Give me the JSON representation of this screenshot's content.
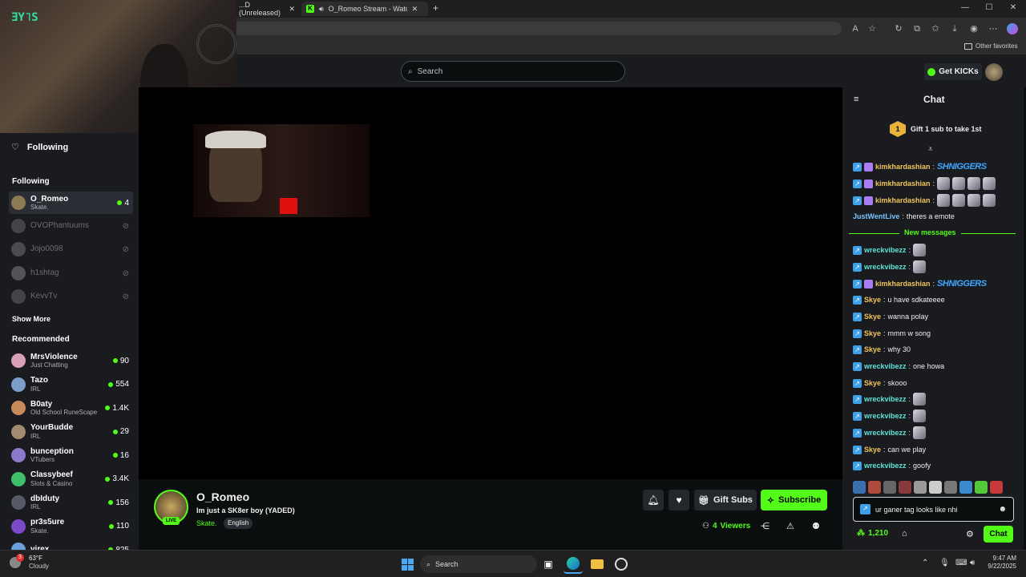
{
  "browser": {
    "tabs": [
      {
        "label": "...D (Unreleased)"
      },
      {
        "label": "O_Romeo Stream - Watch Li..."
      }
    ],
    "other_favorites": "Other favorites"
  },
  "header": {
    "search_placeholder": "Search",
    "get_kicks": "Get KICKs"
  },
  "sidebar": {
    "top_label": "Following",
    "following_title": "Following",
    "following": [
      {
        "name": "O_Romeo",
        "category": "Skate.",
        "viewers": "4",
        "live": true,
        "color": "#8c7a55"
      },
      {
        "name": "OVOPhantuums",
        "live": false,
        "color": "#777"
      },
      {
        "name": "Jojo0098",
        "live": false,
        "color": "#888"
      },
      {
        "name": "h1shtag",
        "live": false,
        "color": "#999"
      },
      {
        "name": "KevvTv",
        "live": false,
        "color": "#777"
      }
    ],
    "show_more": "Show More",
    "recommended_title": "Recommended",
    "recommended": [
      {
        "name": "MrsViolence",
        "category": "Just Chatting",
        "viewers": "90",
        "color": "#d9a0b8"
      },
      {
        "name": "Tazo",
        "category": "IRL",
        "viewers": "554",
        "color": "#7a9ec9"
      },
      {
        "name": "B0aty",
        "category": "Old School RuneScape",
        "viewers": "1.4K",
        "color": "#c98a5a"
      },
      {
        "name": "YourBudde",
        "category": "IRL",
        "viewers": "29",
        "color": "#a08a70"
      },
      {
        "name": "bunception",
        "category": "VTubers",
        "viewers": "16",
        "color": "#8a7ac9"
      },
      {
        "name": "Classybeef",
        "category": "Slots & Casino",
        "viewers": "3.4K",
        "color": "#3fbf6a"
      },
      {
        "name": "dbIduty",
        "category": "IRL",
        "viewers": "156",
        "color": "#555a66"
      },
      {
        "name": "pr3s5ure",
        "category": "Skate.",
        "viewers": "110",
        "color": "#7a4ac9"
      },
      {
        "name": "virex",
        "category": "",
        "viewers": "825",
        "color": "#6aa0d9"
      }
    ]
  },
  "stream": {
    "streamer": "O_Romeo",
    "title": "Im just a SK8er boy (YADED)",
    "category": "Skate.",
    "language": "English",
    "live_badge": "LIVE",
    "viewers": "4",
    "viewers_label": "Viewers",
    "gift_subs": "Gift Subs",
    "subscribe": "Subscribe"
  },
  "chat": {
    "title": "Chat",
    "gift_banner": "Gift 1 sub to take 1st",
    "gift_rank": "1",
    "new_messages": "New messages",
    "messages": [
      {
        "user": "kimkhardashian",
        "color": "#f0c45a",
        "badges": "bg",
        "text": "",
        "emote_text": "SHNIGGERS",
        "emotes": 0
      },
      {
        "user": "kimkhardashian",
        "color": "#f0c45a",
        "badges": "bg",
        "text": "",
        "emote_text": "",
        "emotes": 4
      },
      {
        "user": "kimkhardashian",
        "color": "#f0c45a",
        "badges": "bg",
        "text": "",
        "emote_text": "",
        "emotes": 4
      },
      {
        "user": "JustWentLive",
        "color": "#7cc4ff",
        "badges": "",
        "text": "theres a emote",
        "emote_text": "",
        "emotes": 0
      },
      {
        "user": "wreckvibezz",
        "color": "#5fe3d9",
        "badges": "b",
        "text": "",
        "emote_text": "",
        "emotes": 1
      },
      {
        "user": "wreckvibezz",
        "color": "#5fe3d9",
        "badges": "b",
        "text": "",
        "emote_text": "",
        "emotes": 1
      },
      {
        "user": "kimkhardashian",
        "color": "#f0c45a",
        "badges": "bg",
        "text": "",
        "emote_text": "SHNIGGERS",
        "emotes": 0
      },
      {
        "user": "Skye",
        "color": "#f0c45a",
        "badges": "b",
        "text": "u have sdkateeee",
        "emote_text": "",
        "emotes": 0
      },
      {
        "user": "Skye",
        "color": "#f0c45a",
        "badges": "b",
        "text": "wanna polay",
        "emote_text": "",
        "emotes": 0
      },
      {
        "user": "Skye",
        "color": "#f0c45a",
        "badges": "b",
        "text": "mmm w song",
        "emote_text": "",
        "emotes": 0
      },
      {
        "user": "Skye",
        "color": "#f0c45a",
        "badges": "b",
        "text": "why 30",
        "emote_text": "",
        "emotes": 0
      },
      {
        "user": "wreckvibezz",
        "color": "#5fe3d9",
        "badges": "b",
        "text": "one howa",
        "emote_text": "",
        "emotes": 0
      },
      {
        "user": "Skye",
        "color": "#f0c45a",
        "badges": "b",
        "text": "skooo",
        "emote_text": "",
        "emotes": 0
      },
      {
        "user": "wreckvibezz",
        "color": "#5fe3d9",
        "badges": "b",
        "text": "",
        "emote_text": "",
        "emotes": 1
      },
      {
        "user": "wreckvibezz",
        "color": "#5fe3d9",
        "badges": "b",
        "text": "",
        "emote_text": "",
        "emotes": 1
      },
      {
        "user": "wreckvibezz",
        "color": "#5fe3d9",
        "badges": "b",
        "text": "",
        "emote_text": "",
        "emotes": 1
      },
      {
        "user": "Skye",
        "color": "#f0c45a",
        "badges": "b",
        "text": "can we play",
        "emote_text": "",
        "emotes": 0
      },
      {
        "user": "wreckvibezz",
        "color": "#5fe3d9",
        "badges": "b",
        "text": "goofy",
        "emote_text": "",
        "emotes": 0
      }
    ],
    "input_value": "ur ganer tag looks like nhi",
    "points": "1,210",
    "send": "Chat"
  },
  "taskbar": {
    "temp": "63°F",
    "weather": "Cloudy",
    "weather_alert": "3",
    "search": "Search",
    "time": "9:47 AM",
    "date": "9/22/2025"
  },
  "colors": {
    "accent": "#53fc18",
    "bg": "#0b0e0f",
    "panel": "#191b1f"
  }
}
